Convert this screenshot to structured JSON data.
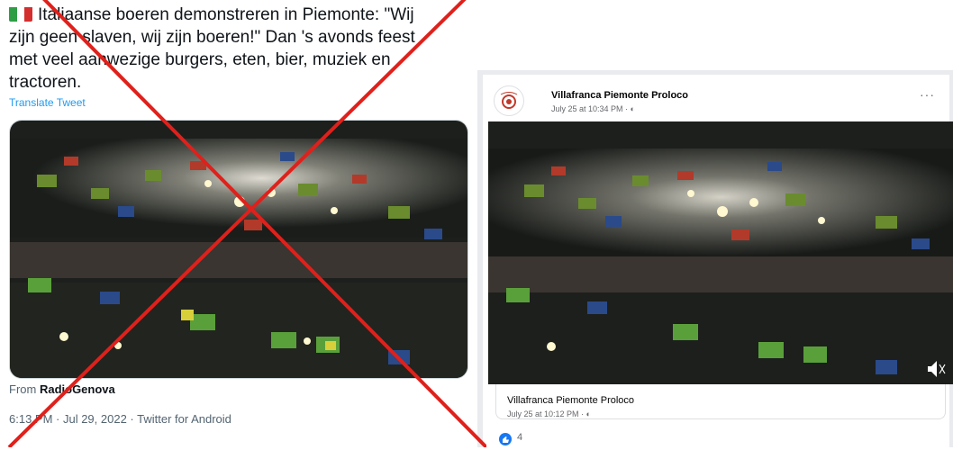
{
  "tweet": {
    "text_line1": "Italiaanse boeren demonstreren in Piemonte: \"Wij",
    "text_line2": "zijn geen slaven, wij zijn boeren!\" Dan 's avonds feest",
    "text_line3": "met veel aanwezige burgers, eten, bier, muziek en",
    "text_line4": "tractoren.",
    "translate": "Translate Tweet",
    "from_prefix": "From ",
    "from_source": "RadioGenova",
    "meta": "6:13 PM · Jul 29, 2022 · Twitter for Android",
    "flag_icon": "italian-flag-icon"
  },
  "facebook": {
    "page_name": "Villafranca Piemonte Proloco",
    "post_date": "July 25 at 10:34 PM · ",
    "more": "···",
    "sub_name": "Villafranca Piemonte Proloco",
    "sub_date": "July 25 at 10:12 PM · ",
    "like_count": "4"
  },
  "colors": {
    "cross": "#e0201b",
    "link": "#1d9bf0",
    "fb_blue": "#1877f2"
  }
}
